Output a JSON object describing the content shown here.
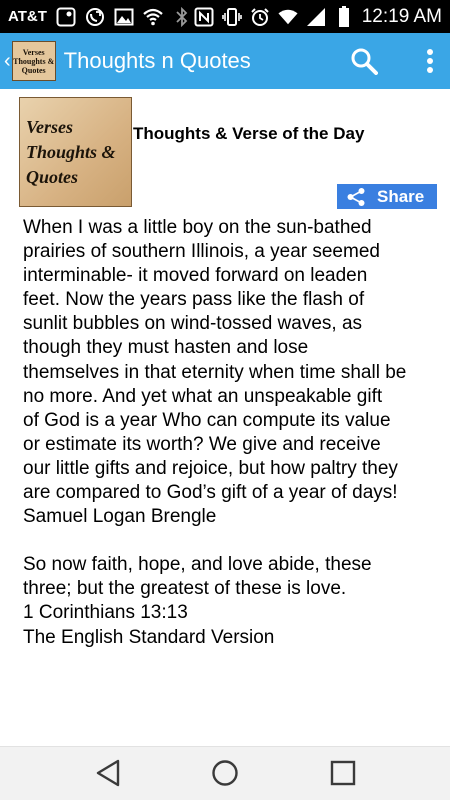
{
  "status_bar": {
    "carrier": "AT&T",
    "time": "12:19 AM",
    "icons": [
      "notification-icon",
      "call-forward-icon",
      "image-icon",
      "wifi-calling-icon",
      "bluetooth-icon",
      "nfc-icon",
      "vibrate-icon",
      "alarm-icon",
      "wifi-icon",
      "signal-icon",
      "battery-icon"
    ]
  },
  "app_bar": {
    "title": "Thoughts n Quotes",
    "logo_lines": [
      "Verses",
      "Thoughts &",
      "Quotes"
    ],
    "background_color": "#3aa6e6",
    "actions": [
      "search-icon",
      "overflow-menu-icon"
    ]
  },
  "content": {
    "logo_lines": [
      "Verses",
      "Thoughts &",
      "Quotes"
    ],
    "heading": "Thoughts & Verse of the Day",
    "share_label": "Share",
    "share_color": "#3a7fe0",
    "quote": "When I was a little boy on the sun-bathed\nprairies of southern Illinois, a year seemed\ninterminable- it moved forward on leaden\nfeet.  Now the years pass like the flash of\nsunlit bubbles on wind-tossed waves, as\nthough they must hasten and lose\nthemselves in that eternity when time shall be\nno more.  And yet what an unspeakable gift\nof God is a year Who can compute its value\nor estimate its worth?  We give and receive\nour little gifts and rejoice, but how paltry they\nare compared to God’s gift of a year of days!",
    "quote_author": "Samuel Logan Brengle",
    "verse": "So now faith, hope, and love abide, these\nthree; but the greatest of these is love.",
    "verse_reference": "1 Corinthians 13:13",
    "verse_version": "The English Standard Version"
  },
  "nav_bar": {
    "buttons": [
      "back-icon",
      "home-icon",
      "recents-icon"
    ]
  }
}
